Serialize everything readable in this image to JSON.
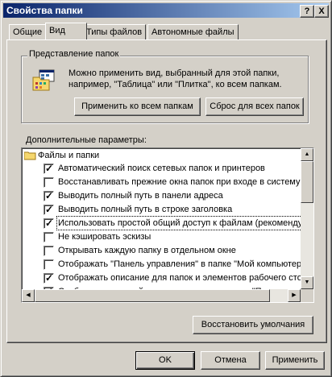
{
  "window": {
    "title": "Свойства папки",
    "help_label": "?",
    "close_label": "X"
  },
  "tabs": [
    {
      "label": "Общие"
    },
    {
      "label": "Вид"
    },
    {
      "label": "Типы файлов"
    },
    {
      "label": "Автономные файлы"
    }
  ],
  "folder_views": {
    "group_label": "Представление папок",
    "description_line1": "Можно применить вид, выбранный для этой папки,",
    "description_line2": "например, \"Таблица\" или \"Плитка\", ко всем папкам.",
    "apply_all_label": "Применить ко всем папкам",
    "reset_all_label": "Сброс для всех папок"
  },
  "advanced": {
    "label": "Дополнительные параметры:",
    "items": [
      {
        "type": "folder",
        "label": "Файлы и папки"
      },
      {
        "type": "checkbox",
        "checked": true,
        "label": "Автоматический поиск сетевых папок и принтеров"
      },
      {
        "type": "checkbox",
        "checked": false,
        "label": "Восстанавливать прежние окна папок при входе в систему"
      },
      {
        "type": "checkbox",
        "checked": true,
        "label": "Выводить полный путь в панели адреса"
      },
      {
        "type": "checkbox",
        "checked": true,
        "label": "Выводить полный путь в строке заголовка"
      },
      {
        "type": "checkbox",
        "checked": true,
        "label": "Использовать простой общий доступ к файлам (рекомендуется)",
        "focused": true
      },
      {
        "type": "checkbox",
        "checked": false,
        "label": "Не кэшировать эскизы"
      },
      {
        "type": "checkbox",
        "checked": false,
        "label": "Открывать каждую папку в отдельном окне"
      },
      {
        "type": "checkbox",
        "checked": false,
        "label": "Отображать \"Панель управления\" в папке \"Мой компьютер\""
      },
      {
        "type": "checkbox",
        "checked": true,
        "label": "Отображать описание для папок и элементов рабочего стола"
      },
      {
        "type": "checkbox",
        "checked": true,
        "label": "Отображать простой вид папок в списке папок \"Проводника\""
      }
    ],
    "restore_defaults_label": "Восстановить умолчания"
  },
  "footer": {
    "ok_label": "OK",
    "cancel_label": "Отмена",
    "apply_label": "Применить"
  },
  "colors": {
    "face": "#d4d0c8",
    "title_start": "#0a246a",
    "title_end": "#a6caf0"
  }
}
